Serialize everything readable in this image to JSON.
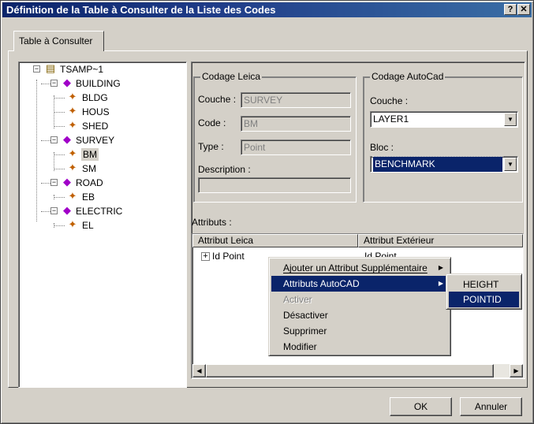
{
  "window": {
    "title": "Définition de la Table à Consulter de la Liste des Codes",
    "help_label": "?",
    "close_label": "✕"
  },
  "tab": {
    "label": "Table à Consulter"
  },
  "tree": {
    "root": "TSAMP~1",
    "groups": [
      {
        "label": "BUILDING",
        "children": [
          "BLDG",
          "HOUS",
          "SHED"
        ]
      },
      {
        "label": "SURVEY",
        "children": [
          "BM",
          "SM"
        ]
      },
      {
        "label": "ROAD",
        "children": [
          "EB"
        ]
      },
      {
        "label": "ELECTRIC",
        "children": [
          "EL"
        ]
      }
    ],
    "selected": "BM",
    "expanded_marker": "−"
  },
  "leica": {
    "title": "Codage Leica",
    "couche_label": "Couche :",
    "couche_value": "SURVEY",
    "code_label": "Code :",
    "code_value": "BM",
    "type_label": "Type :",
    "type_value": "Point",
    "description_label": "Description :",
    "description_value": ""
  },
  "autocad": {
    "title": "Codage AutoCad",
    "couche_label": "Couche :",
    "couche_value": "LAYER1",
    "bloc_label": "Bloc :",
    "bloc_value": "BENCHMARK"
  },
  "attributs": {
    "label": "Attributs :",
    "columns": [
      "Attribut Leica",
      "Attribut Extérieur"
    ],
    "rows": [
      {
        "leica": "Id Point",
        "ext": "Id Point",
        "expander": "+"
      }
    ]
  },
  "context_menu": {
    "items": [
      {
        "label": "Ajouter un Attribut Supplémentaire",
        "submenu": true
      },
      {
        "label": "Attributs AutoCAD",
        "submenu": true
      },
      {
        "label": "Activer",
        "submenu": false
      },
      {
        "label": "Désactiver",
        "submenu": false
      },
      {
        "label": "Supprimer",
        "submenu": false
      },
      {
        "label": "Modifier",
        "submenu": false
      }
    ]
  },
  "submenu": {
    "items": [
      "HEIGHT",
      "POINTID"
    ]
  },
  "buttons": {
    "ok": "OK",
    "annuler": "Annuler"
  },
  "colors": {
    "title_bar": "#0a246a",
    "face": "#d4d0c8",
    "highlight": "#0a246a"
  },
  "icons": {
    "root": "database-icon",
    "group": "layer-group-icon",
    "leaf": "code-icon",
    "submenu": "triangle-right-icon",
    "dropdown": "triangle-down-icon"
  }
}
